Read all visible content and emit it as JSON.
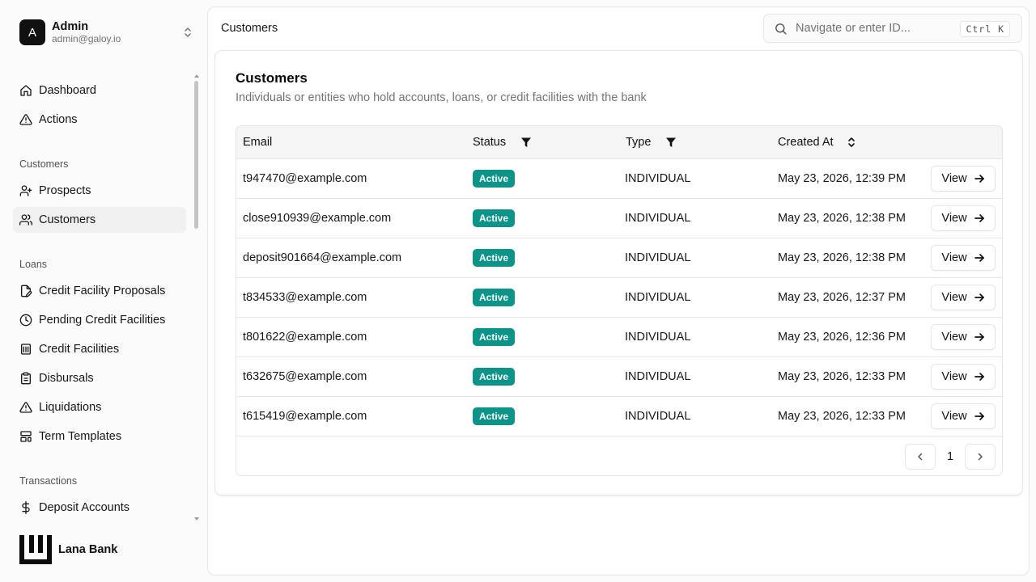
{
  "user": {
    "initial": "A",
    "name": "Admin",
    "email": "admin@galoy.io"
  },
  "nav": {
    "dashboard": "Dashboard",
    "actions": "Actions",
    "section_customers": "Customers",
    "prospects": "Prospects",
    "customers": "Customers",
    "section_loans": "Loans",
    "credit_facility_proposals": "Credit Facility Proposals",
    "pending_credit_facilities": "Pending Credit Facilities",
    "credit_facilities": "Credit Facilities",
    "disbursals": "Disbursals",
    "liquidations": "Liquidations",
    "term_templates": "Term Templates",
    "section_transactions": "Transactions",
    "deposit_accounts": "Deposit Accounts"
  },
  "brand": {
    "name": "Lana Bank"
  },
  "header": {
    "breadcrumb": "Customers",
    "search_placeholder": "Navigate or enter ID...",
    "shortcut": "Ctrl K"
  },
  "card": {
    "title": "Customers",
    "description": "Individuals or entities who hold accounts, loans, or credit facilities with the bank"
  },
  "table": {
    "columns": {
      "email": "Email",
      "status": "Status",
      "type": "Type",
      "created_at": "Created At"
    },
    "view_label": "View",
    "rows": [
      {
        "email": "t947470@example.com",
        "status": "Active",
        "type": "INDIVIDUAL",
        "created_at": "May 23, 2026, 12:39 PM"
      },
      {
        "email": "close910939@example.com",
        "status": "Active",
        "type": "INDIVIDUAL",
        "created_at": "May 23, 2026, 12:38 PM"
      },
      {
        "email": "deposit901664@example.com",
        "status": "Active",
        "type": "INDIVIDUAL",
        "created_at": "May 23, 2026, 12:38 PM"
      },
      {
        "email": "t834533@example.com",
        "status": "Active",
        "type": "INDIVIDUAL",
        "created_at": "May 23, 2026, 12:37 PM"
      },
      {
        "email": "t801622@example.com",
        "status": "Active",
        "type": "INDIVIDUAL",
        "created_at": "May 23, 2026, 12:36 PM"
      },
      {
        "email": "t632675@example.com",
        "status": "Active",
        "type": "INDIVIDUAL",
        "created_at": "May 23, 2026, 12:33 PM"
      },
      {
        "email": "t615419@example.com",
        "status": "Active",
        "type": "INDIVIDUAL",
        "created_at": "May 23, 2026, 12:33 PM"
      }
    ]
  },
  "pagination": {
    "current_page": "1"
  },
  "colors": {
    "status_active": "#0d9488",
    "active_nav_bg": "#f0f0f0"
  }
}
